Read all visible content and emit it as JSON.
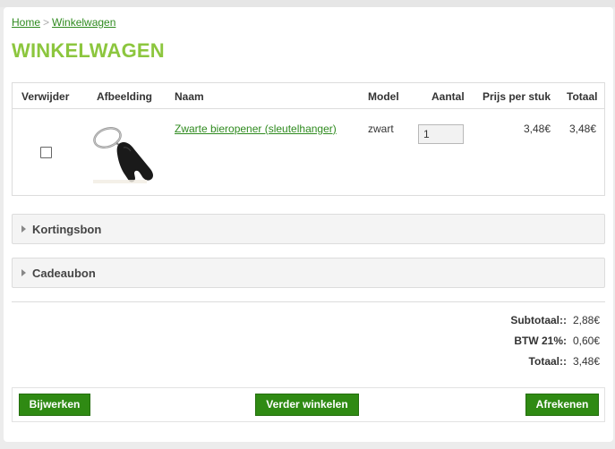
{
  "breadcrumb": {
    "home": "Home",
    "separator": ">",
    "current": "Winkelwagen"
  },
  "page_title": "WINKELWAGEN",
  "cart": {
    "headers": {
      "remove": "Verwijder",
      "image": "Afbeelding",
      "name": "Naam",
      "model": "Model",
      "quantity": "Aantal",
      "unit_price": "Prijs per stuk",
      "total": "Totaal"
    },
    "items": [
      {
        "name": "Zwarte bieropener (sleutelhanger)",
        "model": "zwart",
        "quantity": "1",
        "unit_price": "3,48€",
        "total": "3,48€",
        "remove_checked": false
      }
    ]
  },
  "panels": {
    "coupon": "Kortingsbon",
    "voucher": "Cadeaubon"
  },
  "totals": [
    {
      "label": "Subtotaal::",
      "value": "2,88€"
    },
    {
      "label": "BTW 21%:",
      "value": "0,60€"
    },
    {
      "label": "Totaal::",
      "value": "3,48€"
    }
  ],
  "buttons": {
    "update": "Bijwerken",
    "continue": "Verder winkelen",
    "checkout": "Afrekenen"
  },
  "colors": {
    "title_green": "#8cc63e",
    "link_green": "#2e8a1e",
    "button_green": "#2f8a13"
  }
}
